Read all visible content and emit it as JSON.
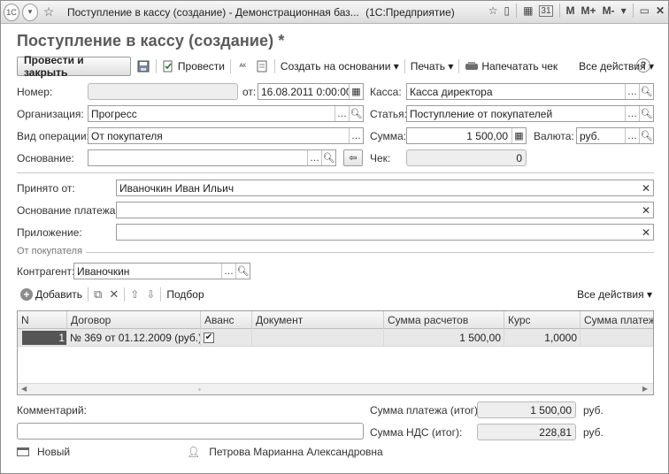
{
  "window": {
    "title": "Поступление в кассу (создание) - Демонстрационная баз...",
    "app": "(1С:Предприятие)",
    "right_controls": [
      "M",
      "M+",
      "M-"
    ]
  },
  "form": {
    "title": "Поступление в кассу (создание) *"
  },
  "toolbar": {
    "post_close": "Провести и закрыть",
    "post": "Провести",
    "create_based": "Создать на основании",
    "print": "Печать",
    "print_check": "Напечатать чек",
    "all_actions": "Все действия"
  },
  "fields": {
    "number_label": "Номер:",
    "number_value": "",
    "from_label": "от:",
    "date_value": "16.08.2011  0:00:00",
    "kassa_label": "Касса:",
    "kassa_value": "Касса директора",
    "org_label": "Организация:",
    "org_value": "Прогресс",
    "statya_label": "Статья:",
    "statya_value": "Поступление от покупателей",
    "optype_label": "Вид операции:",
    "optype_value": "От покупателя",
    "summa_label": "Сумма:",
    "summa_value": "1 500,00",
    "currency_label": "Валюта:",
    "currency_value": "руб.",
    "basis_label": "Основание:",
    "basis_value": "",
    "check_label": "Чек:",
    "check_value": "0",
    "received_label": "Принято от:",
    "received_value": "Иваночкин Иван Ильич",
    "payment_basis_label": "Основание платежа:",
    "payment_basis_value": "",
    "attachment_label": "Приложение:",
    "attachment_value": ""
  },
  "section": {
    "title": "От покупателя",
    "contractor_label": "Контрагент:",
    "contractor_value": "Иваночкин"
  },
  "table_toolbar": {
    "add": "Добавить",
    "pick": "Подбор",
    "all_actions": "Все действия"
  },
  "table": {
    "columns": [
      "N",
      "Договор",
      "Аванс",
      "Документ",
      "Сумма расчетов",
      "Курс",
      "Сумма платежа"
    ],
    "rows": [
      {
        "n": "1",
        "contract": "№ 369 от 01.12.2009 (руб.)",
        "advance": true,
        "document": "",
        "sum": "1 500,00",
        "rate": "1,0000",
        "payment": ""
      }
    ]
  },
  "footer": {
    "comment_label": "Комментарий:",
    "comment_value": "",
    "pay_total_label": "Сумма платежа (итог):",
    "pay_total_value": "1 500,00",
    "pay_total_unit": "руб.",
    "vat_total_label": "Сумма НДС (итог):",
    "vat_total_value": "228,81",
    "vat_total_unit": "руб."
  },
  "status": {
    "state": "Новый",
    "user": "Петрова Марианна Александровна"
  }
}
